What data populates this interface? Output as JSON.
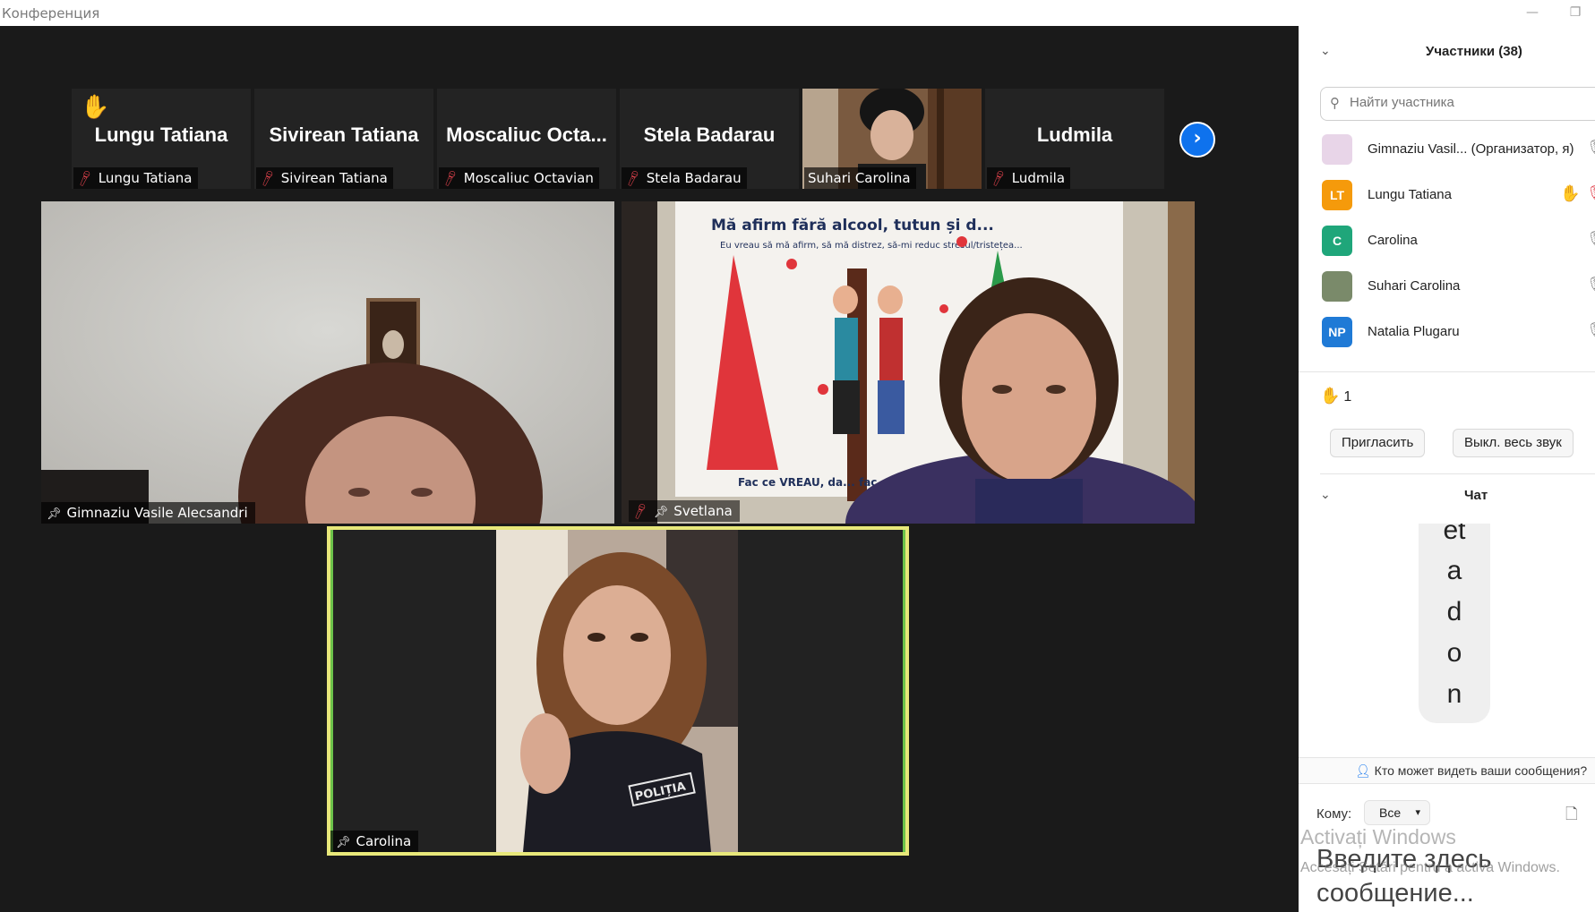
{
  "window": {
    "title": "Конференция",
    "minimize": "—",
    "restore": "❐"
  },
  "thumbnails": [
    {
      "big_name": "Lungu Tatiana",
      "label": "Lungu Tatiana",
      "muted": true,
      "hand_raised": true
    },
    {
      "big_name": "Sivirean Tatiana",
      "label": "Sivirean Tatiana",
      "muted": true
    },
    {
      "big_name": "Moscaliuc  Octa...",
      "label": "Moscaliuc Octavian",
      "muted": true
    },
    {
      "big_name": "Stela Badarau",
      "label": "Stela Badarau",
      "muted": true
    },
    {
      "big_name": "",
      "label": "Suhari Carolina",
      "muted": false,
      "video": true
    },
    {
      "big_name": "Ludmila",
      "label": "Ludmila",
      "muted": true
    }
  ],
  "tiles": {
    "gimnaziu": {
      "label": "Gimnaziu Vasile Alecsandri"
    },
    "svetlana": {
      "label": "Svetlana"
    },
    "carolina": {
      "label": "Carolina"
    }
  },
  "poster": {
    "title": "Mă afirm fără alcool, tutun și d...",
    "subtitle": "Eu vreau să mă afirm, să mă distrez, să-mi reduc stresul/tristețea...",
    "bottom": "Fac ce VREAU, da... fac..."
  },
  "badge_text": "POLIȚIA",
  "participants_panel": {
    "title": "Участники (38)",
    "search_placeholder": "Найти участника",
    "participants": [
      {
        "name": "Gimnaziu Vasil...  (Организатор, я)",
        "initials": "",
        "avatar_color": "#e8d5e8",
        "mic": "on"
      },
      {
        "name": "Lungu Tatiana",
        "initials": "LT",
        "avatar_color": "#f59a0b",
        "mic": "muted",
        "hand": true
      },
      {
        "name": "Carolina",
        "initials": "C",
        "avatar_color": "#1fa67a",
        "mic": "on"
      },
      {
        "name": "Suhari Carolina",
        "initials": "",
        "avatar_color": "#7a8a6a",
        "mic": "on"
      },
      {
        "name": "Natalia Plugaru",
        "initials": "NP",
        "avatar_color": "#1f7ad6",
        "mic": "on"
      },
      {
        "name": "",
        "initials": "",
        "avatar_color": "#1fa67a",
        "mic": "muted"
      }
    ],
    "raised_hands": "1",
    "invite_label": "Пригласить",
    "mute_all_label": "Выкл. весь звук"
  },
  "chat": {
    "title": "Чат",
    "message_chars": [
      "et",
      "a",
      "d",
      "o",
      "n"
    ],
    "visibility_note": "Кто может видеть ваши сообщения?",
    "to_label": "Кому:",
    "recipient": "Все",
    "input_placeholder": "Введите здесь сообщение..."
  },
  "watermark": {
    "line1": "Activați Windows",
    "line2": "Accesați Setări pentru a activa Windows."
  },
  "colors": {
    "stage_bg": "#1a1a1a",
    "active_speaker_border": "#e8e87a",
    "muted_red": "#e0424c",
    "accent_blue": "#0e72ed",
    "hand_yellow": "#f5b21b"
  },
  "icons": {
    "next_page": "chevron-right-icon",
    "search": "search-icon",
    "pin": "pin-icon",
    "mic_muted": "mic-muted-icon",
    "raise_hand": "raise-hand-icon",
    "file": "file-icon"
  }
}
